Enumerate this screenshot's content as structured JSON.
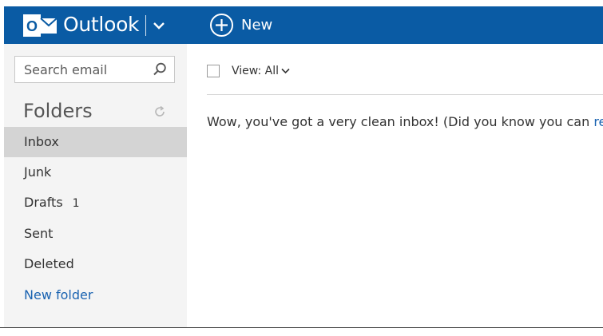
{
  "app": {
    "brand": "Outlook",
    "new_label": "New"
  },
  "search": {
    "placeholder": "Search email"
  },
  "sidebar": {
    "heading": "Folders",
    "items": [
      {
        "label": "Inbox",
        "count": "",
        "selected": true
      },
      {
        "label": "Junk",
        "count": ""
      },
      {
        "label": "Drafts",
        "count": "1"
      },
      {
        "label": "Sent",
        "count": ""
      },
      {
        "label": "Deleted",
        "count": ""
      }
    ],
    "new_folder": "New folder"
  },
  "main": {
    "view_label": "View: All",
    "message": "Wow, you've got a very clean inbox! (Did you know you can ",
    "message_link": "re"
  },
  "colors": {
    "topbar": "#0a5ba4",
    "link": "#1a63b1",
    "sidebar_bg": "#f4f4f4",
    "selected_bg": "#d4d4d4"
  },
  "icons": {
    "logo": "outlook-logo-icon",
    "switcher": "chevron-down-icon",
    "new": "plus-circle-icon",
    "search": "search-icon",
    "refresh": "refresh-icon"
  }
}
